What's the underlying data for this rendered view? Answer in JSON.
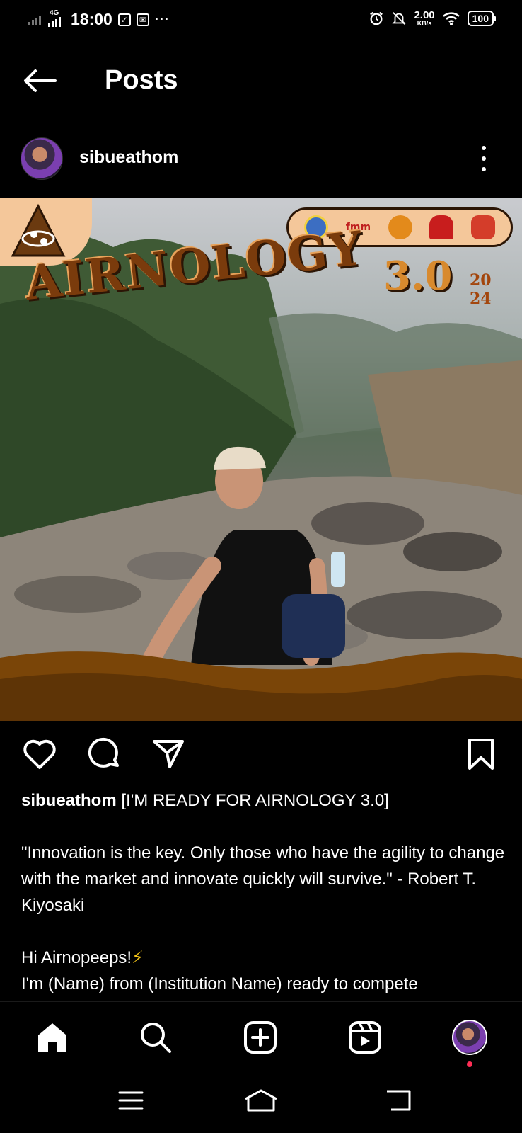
{
  "status_bar": {
    "network": "4G",
    "time": "18:00",
    "more": "···",
    "speed_value": "2.00",
    "speed_unit": "KB/s",
    "battery": "100",
    "icons": [
      "signal-icon",
      "network-4g-icon",
      "shield-check-icon",
      "mail-icon",
      "alarm-icon",
      "mute-icon",
      "wifi-icon",
      "battery-icon"
    ]
  },
  "header": {
    "title": "Posts",
    "back_icon": "arrow-left-icon"
  },
  "post": {
    "username": "sibueathom",
    "more_icon": "more-vertical-icon",
    "image": {
      "title": "AIRNOLOGY",
      "version": "3.0",
      "year_top": "20",
      "year_bottom": "24",
      "sponsor_text": "fmm",
      "description": "Young man with cap and backpack sitting in rocky volcanic crater with forest background"
    },
    "actions": [
      "heart-icon",
      "comment-icon",
      "share-icon",
      "bookmark-icon"
    ],
    "caption": {
      "username": "sibueathom",
      "headline": "[I'M READY FOR AIRNOLOGY 3.0]",
      "quote": "\"Innovation is the key. Only those who have the agility to change with the market and innovate quickly will survive.\" - Robert T. Kiyosaki",
      "greeting": "Hi Airnopeeps!",
      "greeting_emoji": "⚡",
      "line2": "I'm (Name) from (Institution Name) ready to compete"
    }
  },
  "bottom_nav": {
    "items": [
      "home-icon",
      "search-icon",
      "create-icon",
      "reels-icon",
      "profile-avatar"
    ]
  },
  "system_nav": {
    "items": [
      "menu-icon",
      "home-outline-icon",
      "back-icon"
    ]
  },
  "colors": {
    "background": "#000000",
    "text": "#ffffff",
    "accent_orange": "#d88a2e",
    "brand_brown": "#7a3b0c",
    "notification": "#ff2d55"
  }
}
